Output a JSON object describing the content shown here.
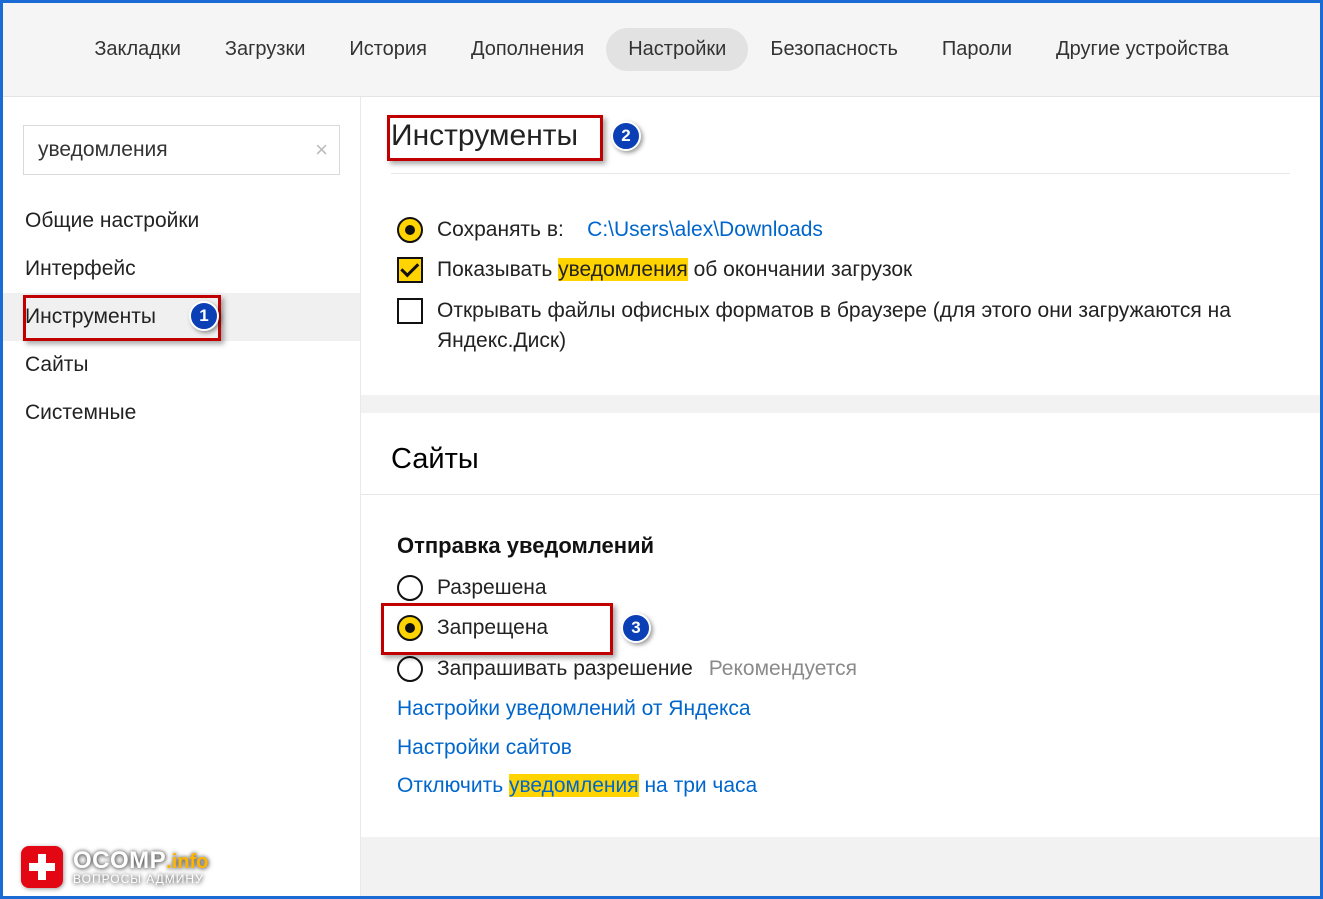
{
  "topbar": {
    "tabs": [
      "Закладки",
      "Загрузки",
      "История",
      "Дополнения",
      "Настройки",
      "Безопасность",
      "Пароли",
      "Другие устройства"
    ],
    "active_index": 4
  },
  "sidebar": {
    "search_value": "уведомления",
    "items": [
      "Общие настройки",
      "Интерфейс",
      "Инструменты",
      "Сайты",
      "Системные"
    ],
    "selected_index": 2
  },
  "tools": {
    "title": "Инструменты",
    "save_to_label": "Сохранять в:",
    "save_to_path": "C:\\Users\\alex\\Downloads",
    "notify_prefix": "Показывать ",
    "notify_hl": "уведомления",
    "notify_suffix": " об окончании загрузок",
    "office_label": "Открывать файлы офисных форматов в браузере (для этого они загружаются на Яндекс.Диск)"
  },
  "sites": {
    "title": "Сайты",
    "sub_title": "Отправка уведомлений",
    "opt_allow": "Разрешена",
    "opt_deny": "Запрещена",
    "opt_ask": "Запрашивать разрешение",
    "recommended": "Рекомендуется",
    "link1": "Настройки уведомлений от Яндекса",
    "link2": "Настройки сайтов",
    "link3_prefix": "Отключить ",
    "link3_hl": "уведомления",
    "link3_suffix": " на три часа"
  },
  "badges": {
    "b1": "1",
    "b2": "2",
    "b3": "3"
  },
  "watermark": {
    "brand": "OCOMP",
    "suffix": ".info",
    "sub": "ВОПРОСЫ АДМИНУ"
  }
}
